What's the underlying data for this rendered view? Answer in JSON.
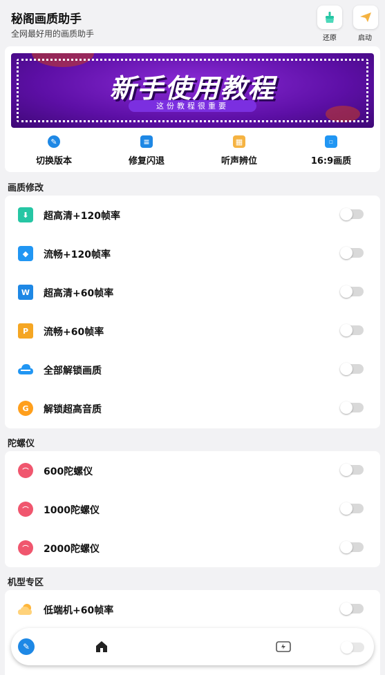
{
  "header": {
    "title": "秘阁画质助手",
    "subtitle": "全网最好用的画质助手",
    "restore_label": "还原",
    "launch_label": "启动"
  },
  "banner": {
    "title": "新手使用教程",
    "subtitle": "这份教程很重要"
  },
  "quick_actions": [
    {
      "label": "切换版本",
      "icon": "pen-icon",
      "color": "#1e88e5"
    },
    {
      "label": "修复闪退",
      "icon": "layers-icon",
      "color": "#1e88e5"
    },
    {
      "label": "听声辨位",
      "icon": "package-icon",
      "color": "#f5b342"
    },
    {
      "label": "16:9画质",
      "icon": "screen-icon",
      "color": "#2196f3"
    }
  ],
  "sections": {
    "quality": {
      "title": "画质修改",
      "items": [
        {
          "label": "超高清+120帧率",
          "icon": "download-icon",
          "color": "#26c6a4",
          "enabled": false
        },
        {
          "label": "流畅+120帧率",
          "icon": "layers-icon",
          "color": "#2196f3",
          "enabled": false
        },
        {
          "label": "超高清+60帧率",
          "icon": "word-icon",
          "color": "#1e88e5",
          "enabled": false
        },
        {
          "label": "流畅+60帧率",
          "icon": "p-icon",
          "color": "#f5a623",
          "enabled": false
        },
        {
          "label": "全部解锁画质",
          "icon": "cloud-icon",
          "color": "#2196f3",
          "enabled": false
        },
        {
          "label": "解锁超高音质",
          "icon": "g-icon",
          "color": "#ff9f1c",
          "enabled": false
        }
      ]
    },
    "gyro": {
      "title": "陀螺仪",
      "items": [
        {
          "label": "600陀螺仪",
          "icon": "gyro-icon",
          "color": "#f0566e",
          "enabled": false
        },
        {
          "label": "1000陀螺仪",
          "icon": "gyro-icon",
          "color": "#f0566e",
          "enabled": false
        },
        {
          "label": "2000陀螺仪",
          "icon": "gyro-icon",
          "color": "#f0566e",
          "enabled": false
        }
      ]
    },
    "device": {
      "title": "机型专区",
      "items": [
        {
          "label": "低端机+60帧率",
          "icon": "sun-cloud-icon",
          "color": "#ffb63b",
          "enabled": false
        }
      ]
    }
  },
  "nav": {
    "items": [
      "pen-icon",
      "home-icon",
      "gamepad-icon"
    ]
  }
}
